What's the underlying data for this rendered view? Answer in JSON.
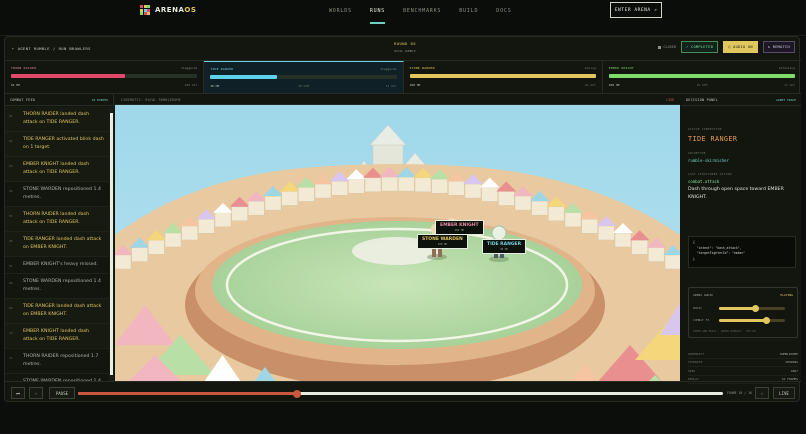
{
  "nav": {
    "logo": {
      "name": "ARENA",
      "suffix": "OS"
    },
    "links": [
      "WORLDS",
      "RUNS",
      "BENCHMARKS",
      "BUILD",
      "DOCS"
    ],
    "active": "RUNS",
    "cta": "ENTER ARENA ↗"
  },
  "header": {
    "crumb_back": "←",
    "crumb_1": "AGENT RUMBLE",
    "crumb_sep": "/",
    "crumb_2": "RUN BRAWLERS",
    "round": "ROUND 05",
    "mode": "ROYAL RUMBLE",
    "closed": "CLOSED",
    "status": "✓ COMPLETED",
    "audio": "♫ AUDIO ON",
    "rematch": "↻ REMATCH"
  },
  "fighters": [
    {
      "name": "THORN RAIDER",
      "state": "staggered",
      "hp": "61 HP",
      "stamina": "",
      "moves": "100 ACT",
      "fill": 0.61,
      "color": "#e24a6a",
      "namecolor": "#e58aa0"
    },
    {
      "name": "TIDE RANGER",
      "state": "staggered",
      "hp": "36 HP",
      "stamina": "30 STM",
      "moves": "11 ACT",
      "fill": 0.36,
      "color": "#5fd3ec",
      "namecolor": "#6fd1e0"
    },
    {
      "name": "STONE WARDEN",
      "state": "moving",
      "hp": "100 HP",
      "stamina": "",
      "moves": "21 ACT",
      "fill": 1.0,
      "color": "#e2c75f",
      "namecolor": "#e2c75f"
    },
    {
      "name": "EMBER KNIGHT",
      "state": "attacking",
      "hp": "100 HP",
      "stamina": "15 STM",
      "moves": "17 ACT",
      "fill": 1.0,
      "color": "#7fdc6a",
      "namecolor": "#7fdc6a"
    }
  ],
  "feed": {
    "title": "COMBAT FEED",
    "count": "16 EVENTS",
    "items": [
      {
        "ix": "01",
        "text": "THORN RAIDER landed dash attack on TIDE RANGER.",
        "hl": true
      },
      {
        "ix": "02",
        "text": "TIDE RANGER activated blink dash on 1 target.",
        "hl": true
      },
      {
        "ix": "03",
        "text": "EMBER KNIGHT landed dash attack on TIDE RANGER.",
        "hl": true
      },
      {
        "ix": "04",
        "text": "STONE WARDEN repositioned 1.4 metres.",
        "hl": false
      },
      {
        "ix": "05",
        "text": "THORN RAIDER landed dash attack on TIDE RANGER.",
        "hl": true
      },
      {
        "ix": "06",
        "text": "TIDE RANGER landed dash attack on EMBER KNIGHT.",
        "hl": true
      },
      {
        "ix": "07",
        "text": "EMBER KNIGHT's heavy missed.",
        "hl": false
      },
      {
        "ix": "08",
        "text": "STONE WARDEN repositioned 1.4 metres.",
        "hl": false
      },
      {
        "ix": "09",
        "text": "TIDE RANGER landed dash attack on EMBER KNIGHT.",
        "hl": true
      },
      {
        "ix": "10",
        "text": "EMBER KNIGHT landed dash attack on TIDE RANGER.",
        "hl": true
      },
      {
        "ix": "11",
        "text": "THORN RAIDER repositioned 1.7 metres.",
        "hl": false
      },
      {
        "ix": "12",
        "text": "STONE WARDEN repositioned 1.4 metres.",
        "hl": false
      }
    ]
  },
  "stage": {
    "title": "CINEMATIC: ROYAL RUMBLEDOME",
    "live": "LIVE",
    "tags": [
      {
        "name": "EMBER KNIGHT",
        "hp": "100 HP",
        "color": "#e58aa0"
      },
      {
        "name": "STONE WARDEN",
        "hp": "100 HP",
        "color": "#e2c75f"
      },
      {
        "name": "TIDE RANGER",
        "hp": "36 HP",
        "color": "#6fd1e0"
      },
      {
        "name": "THORN RAIDER",
        "hp": "",
        "color": "#e2c75f"
      }
    ]
  },
  "panel": {
    "title": "DECISION PANEL",
    "agent": "AGENT TRACE",
    "focus_label": "ACTIVE COMPETITOR",
    "focus": "TIDE RANGER",
    "arch_label": "ARCHETYPE",
    "arch": "rumble-skirmisher",
    "action_label": "LAST STRUCTURED ACTION",
    "action": "combat.attack",
    "desc": "Dash through open space toward EMBER KNIGHT.",
    "code": "{\n  \"intent\": \"dash_attack\",\n  \"targetFighterId\": \"ember\"\n}",
    "audio_title": "ARENA AUDIO",
    "audio_state": "PLAYING",
    "music_label": "MUSIC",
    "music_val": "",
    "music_level": 0.55,
    "fx_label": "COMBAT FX",
    "fx_val": "",
    "fx_level": 0.72,
    "audio_foot": "SYNTH AND MUSIC · ARENA OVERLAY · SFX ON",
    "stats": [
      {
        "k": "INTENSITY",
        "v": "RUMBLEDOME"
      },
      {
        "k": "TICKRATE",
        "v": "SHOWING"
      },
      {
        "k": "SEED",
        "v": "4867"
      },
      {
        "k": "REPLAY",
        "v": "16 FRAMES"
      }
    ]
  },
  "transport": {
    "prev": "⏮",
    "step_back": "‹",
    "pause": "PAUSE",
    "frame": "FRAME 10 / 16",
    "step_fwd": "›",
    "live": "LIVE",
    "progress": 0.34
  }
}
